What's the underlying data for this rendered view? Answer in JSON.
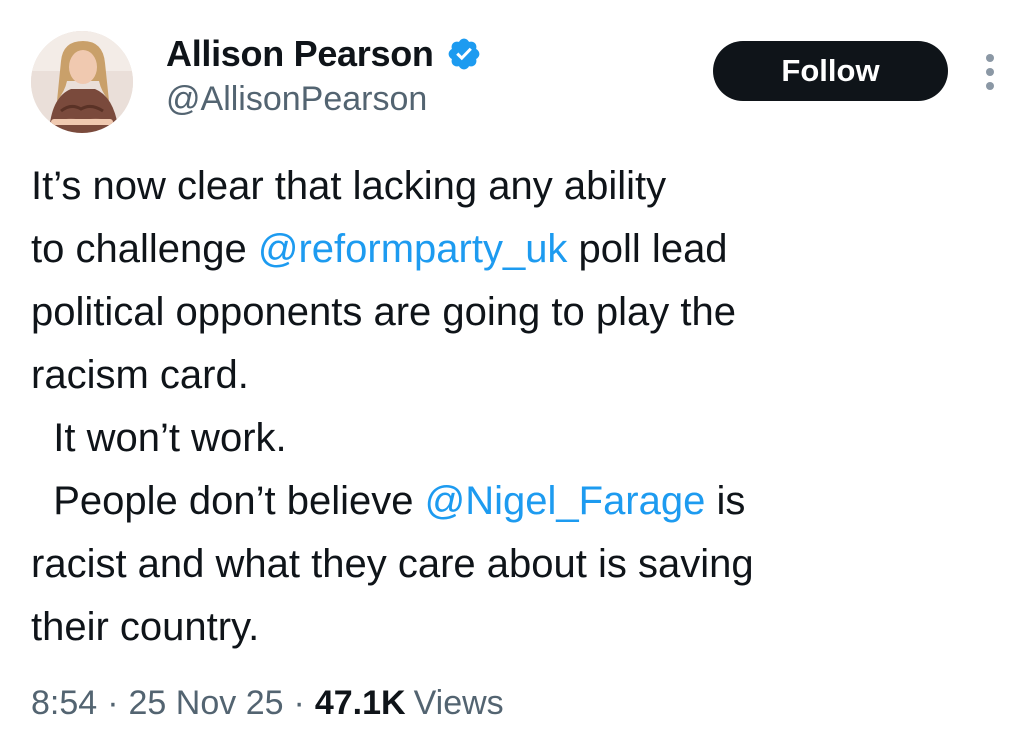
{
  "author": {
    "display_name": "Allison Pearson",
    "handle": "@AllisonPearson",
    "verified": true,
    "avatar_icon": "profile-photo"
  },
  "actions": {
    "follow_label": "Follow",
    "more_icon": "more-vertical-icon"
  },
  "tweet": {
    "lines": [
      [
        {
          "text": "It’s now clear that lacking any ability"
        }
      ],
      [
        {
          "text": "to challenge "
        },
        {
          "text": "@reformparty_uk",
          "mention": true
        },
        {
          "text": " poll lead"
        }
      ],
      [
        {
          "text": "political opponents are going to play the"
        }
      ],
      [
        {
          "text": "racism card."
        }
      ],
      [
        {
          "text": "  It won’t work."
        }
      ],
      [
        {
          "text": "  People don’t believe "
        },
        {
          "text": "@Nigel_Farage",
          "mention": true
        },
        {
          "text": " is"
        }
      ],
      [
        {
          "text": "racist and what they care about is saving"
        }
      ],
      [
        {
          "text": "their country."
        }
      ]
    ]
  },
  "meta": {
    "time": "8:54",
    "separator": "·",
    "date": "25 Nov 25",
    "views_count": "47.1K",
    "views_label": "Views"
  },
  "colors": {
    "text": "#0f1419",
    "secondary": "#536471",
    "link": "#1d9bf0",
    "button_bg": "#0f1419",
    "verified_badge": "#1d9bf0"
  }
}
